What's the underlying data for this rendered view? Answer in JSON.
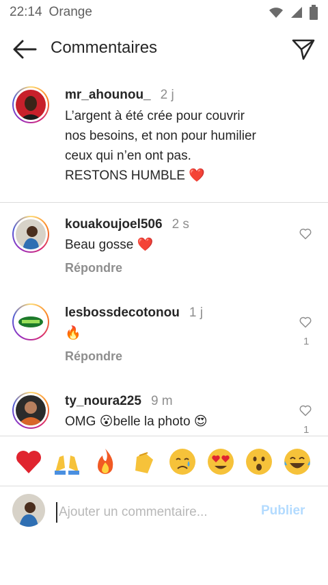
{
  "status": {
    "time": "22:14",
    "carrier": "Orange"
  },
  "header": {
    "title": "Commentaires"
  },
  "caption": {
    "username": "mr_ahounou_",
    "time": "2 j",
    "line1": "L’argent à été crée pour couvrir",
    "line2": "nos besoins, et non pour humilier",
    "line3": "ceux qui n’en ont pas.",
    "line4": "RESTONS HUMBLE ❤️"
  },
  "comments": [
    {
      "username": "kouakoujoel506",
      "time": "2 s",
      "text": "Beau gosse ❤️",
      "reply": "Répondre",
      "likes": ""
    },
    {
      "username": "lesbossdecotonou",
      "time": "1 j",
      "text": "🔥",
      "reply": "Répondre",
      "likes": "1"
    },
    {
      "username": "ty_noura225",
      "time": "9 m",
      "text": "OMG 😮belle la photo 😍",
      "reply": "",
      "likes": "1"
    }
  ],
  "emoji_bar": [
    "❤️",
    "🙌",
    "🔥",
    "👏",
    "😢",
    "😍",
    "😮",
    "😂"
  ],
  "composer": {
    "placeholder": "Ajouter un commentaire...",
    "publish_label": "Publier"
  },
  "colors": {
    "accent_disabled": "#b3dbff",
    "secondary_text": "#8e8e8e",
    "divider": "#dbdbdb"
  }
}
